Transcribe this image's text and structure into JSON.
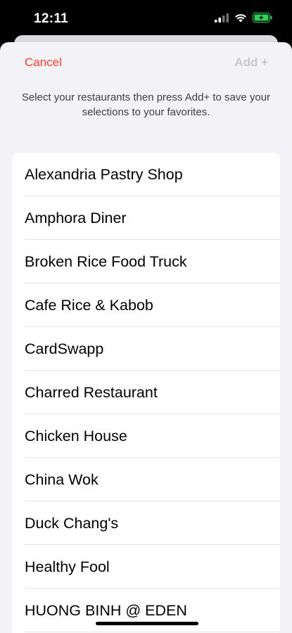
{
  "status_bar": {
    "time": "12:11",
    "icons": [
      "signal-icon",
      "wifi-icon",
      "battery-charging-icon"
    ]
  },
  "header": {
    "cancel_label": "Cancel",
    "add_label": "Add +"
  },
  "instructions": "Select your restaurants then press Add+ to save your selections to your favorites.",
  "restaurants": [
    "Alexandria Pastry Shop",
    "Amphora Diner",
    "Broken Rice Food Truck",
    "Cafe Rice & Kabob",
    "CardSwapp",
    "Charred Restaurant",
    "Chicken House",
    "China Wok",
    "Duck Chang's",
    "Healthy Fool",
    "HUONG BINH @ EDEN"
  ],
  "colors": {
    "cancel": "#ff3b30",
    "add_disabled": "#c7c7cc",
    "sheet_background": "#f2f2f7",
    "battery": "#30d158"
  }
}
